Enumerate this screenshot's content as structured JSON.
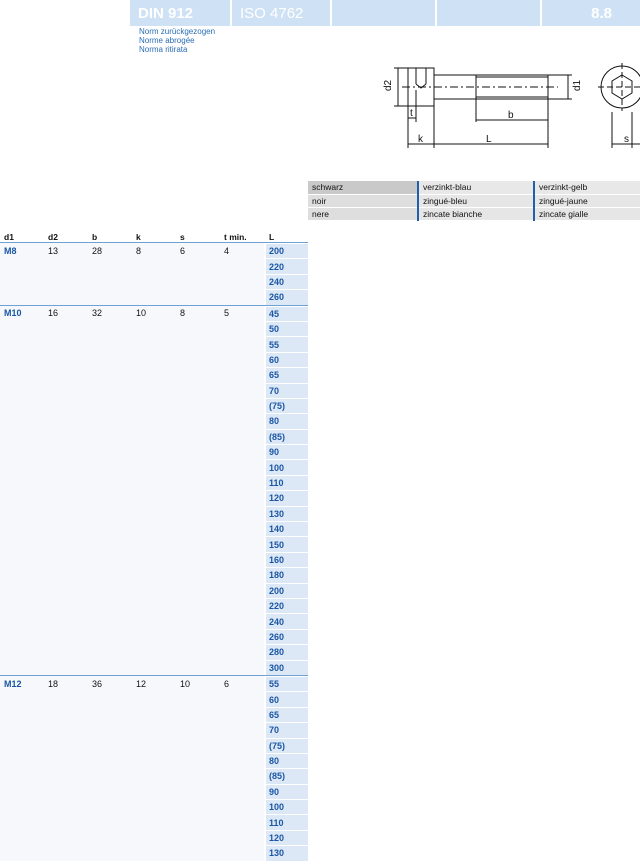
{
  "header": {
    "standard": "DIN 912",
    "iso": "ISO 4762",
    "grade": "8.8"
  },
  "norm_withdrawn": [
    "Norm zurückgezogen",
    "Norme abrogée",
    "Norma ritirata"
  ],
  "drawing": {
    "labels": [
      "d2",
      "d1",
      "t",
      "b",
      "k",
      "L",
      "s"
    ]
  },
  "finish": {
    "rows": [
      [
        "schwarz",
        "verzinkt-blau",
        "verzinkt-gelb"
      ],
      [
        "noir",
        "zingué-bleu",
        "zingué-jaune"
      ],
      [
        "nere",
        "zincate bianche",
        "zincate gialle"
      ]
    ]
  },
  "table": {
    "headers": {
      "d1": "d1",
      "d2": "d2",
      "b": "b",
      "k": "k",
      "s": "s",
      "t": "t min.",
      "L": "L"
    },
    "groups": [
      {
        "d1": "M8",
        "d2": "13",
        "b": "28",
        "k": "8",
        "s": "6",
        "t": "4",
        "L": [
          "200",
          "220",
          "240",
          "260"
        ]
      },
      {
        "d1": "M10",
        "d2": "16",
        "b": "32",
        "k": "10",
        "s": "8",
        "t": "5",
        "L": [
          "45",
          "50",
          "55",
          "60",
          "65",
          "70",
          "(75)",
          "80",
          "(85)",
          "90",
          "100",
          "110",
          "120",
          "130",
          "140",
          "150",
          "160",
          "180",
          "200",
          "220",
          "240",
          "260",
          "280",
          "300"
        ]
      },
      {
        "d1": "M12",
        "d2": "18",
        "b": "36",
        "k": "12",
        "s": "10",
        "t": "6",
        "L": [
          "55",
          "60",
          "65",
          "70",
          "(75)",
          "80",
          "(85)",
          "90",
          "100",
          "110",
          "120",
          "130"
        ]
      }
    ]
  },
  "colors": {
    "accent": "#1a56a6",
    "band": "#cfe1f4",
    "lcol": "#dce8f5"
  }
}
